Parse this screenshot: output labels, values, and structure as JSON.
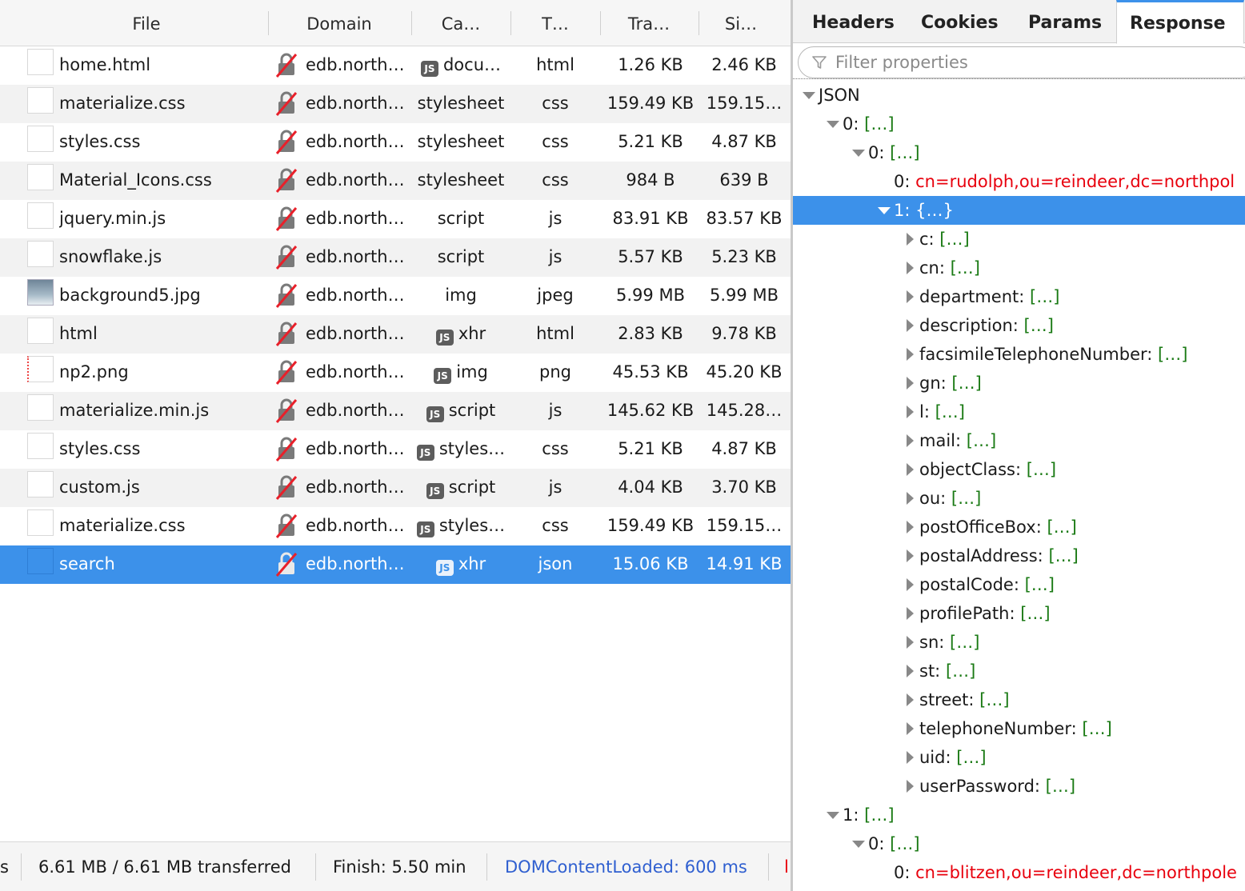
{
  "columns": {
    "file": "File",
    "domain": "Domain",
    "cause": "Ca…",
    "type": "T…",
    "transferred": "Tra…",
    "size": "Si…"
  },
  "requests": [
    {
      "file": "home.html",
      "domain": "edb.north…",
      "cause": "docu…",
      "cause_js": true,
      "type": "html",
      "transferred": "1.26 KB",
      "size": "2.46 KB",
      "thumb": "blank"
    },
    {
      "file": "materialize.css",
      "domain": "edb.north…",
      "cause": "stylesheet",
      "cause_js": false,
      "type": "css",
      "transferred": "159.49 KB",
      "size": "159.15…",
      "thumb": "blank"
    },
    {
      "file": "styles.css",
      "domain": "edb.north…",
      "cause": "stylesheet",
      "cause_js": false,
      "type": "css",
      "transferred": "5.21 KB",
      "size": "4.87 KB",
      "thumb": "blank"
    },
    {
      "file": "Material_Icons.css",
      "domain": "edb.north…",
      "cause": "stylesheet",
      "cause_js": false,
      "type": "css",
      "transferred": "984 B",
      "size": "639 B",
      "thumb": "blank"
    },
    {
      "file": "jquery.min.js",
      "domain": "edb.north…",
      "cause": "script",
      "cause_js": false,
      "type": "js",
      "transferred": "83.91 KB",
      "size": "83.57 KB",
      "thumb": "blank"
    },
    {
      "file": "snowflake.js",
      "domain": "edb.north…",
      "cause": "script",
      "cause_js": false,
      "type": "js",
      "transferred": "5.57 KB",
      "size": "5.23 KB",
      "thumb": "blank"
    },
    {
      "file": "background5.jpg",
      "domain": "edb.north…",
      "cause": "img",
      "cause_js": false,
      "type": "jpeg",
      "transferred": "5.99 MB",
      "size": "5.99 MB",
      "thumb": "img"
    },
    {
      "file": "html",
      "domain": "edb.north…",
      "cause": "xhr",
      "cause_js": true,
      "type": "html",
      "transferred": "2.83 KB",
      "size": "9.78 KB",
      "thumb": "blank"
    },
    {
      "file": "np2.png",
      "domain": "edb.north…",
      "cause": "img",
      "cause_js": true,
      "type": "png",
      "transferred": "45.53 KB",
      "size": "45.20 KB",
      "thumb": "png"
    },
    {
      "file": "materialize.min.js",
      "domain": "edb.north…",
      "cause": "script",
      "cause_js": true,
      "type": "js",
      "transferred": "145.62 KB",
      "size": "145.28…",
      "thumb": "blank"
    },
    {
      "file": "styles.css",
      "domain": "edb.north…",
      "cause": "styles…",
      "cause_js": true,
      "type": "css",
      "transferred": "5.21 KB",
      "size": "4.87 KB",
      "thumb": "blank"
    },
    {
      "file": "custom.js",
      "domain": "edb.north…",
      "cause": "script",
      "cause_js": true,
      "type": "js",
      "transferred": "4.04 KB",
      "size": "3.70 KB",
      "thumb": "blank"
    },
    {
      "file": "materialize.css",
      "domain": "edb.north…",
      "cause": "styles…",
      "cause_js": true,
      "type": "css",
      "transferred": "159.49 KB",
      "size": "159.15…",
      "thumb": "blank"
    },
    {
      "file": "search",
      "domain": "edb.north…",
      "cause": "xhr",
      "cause_js": true,
      "type": "json",
      "transferred": "15.06 KB",
      "size": "14.91 KB",
      "thumb": "blank",
      "selected": true
    }
  ],
  "js_badge": "JS",
  "status": {
    "requests_fragment": "s",
    "transferred": "6.61 MB / 6.61 MB transferred",
    "finish": "Finish: 5.50 min",
    "dom_content_loaded": "DOMContentLoaded: 600 ms",
    "load_fragment": "l"
  },
  "tabs": [
    "Headers",
    "Cookies",
    "Params",
    "Response"
  ],
  "active_tab": "Response",
  "filter": {
    "placeholder": "Filter properties"
  },
  "tree": [
    {
      "depth": 0,
      "twisty": "down",
      "key": "JSON",
      "value": ""
    },
    {
      "depth": 1,
      "twisty": "down",
      "key": "0: ",
      "value": "[…]"
    },
    {
      "depth": 2,
      "twisty": "down",
      "key": "0: ",
      "value": "[…]"
    },
    {
      "depth": 3,
      "twisty": "none",
      "key": "0: ",
      "value": "cn=rudolph,ou=reindeer,dc=northpol",
      "string": true
    },
    {
      "depth": 3,
      "twisty": "down",
      "key": "1: ",
      "value": "{…}",
      "selected": true
    },
    {
      "depth": 4,
      "twisty": "right",
      "key": "c: ",
      "value": "[…]"
    },
    {
      "depth": 4,
      "twisty": "right",
      "key": "cn: ",
      "value": "[…]"
    },
    {
      "depth": 4,
      "twisty": "right",
      "key": "department: ",
      "value": "[…]"
    },
    {
      "depth": 4,
      "twisty": "right",
      "key": "description: ",
      "value": "[…]"
    },
    {
      "depth": 4,
      "twisty": "right",
      "key": "facsimileTelephoneNumber: ",
      "value": "[…]"
    },
    {
      "depth": 4,
      "twisty": "right",
      "key": "gn: ",
      "value": "[…]"
    },
    {
      "depth": 4,
      "twisty": "right",
      "key": "l: ",
      "value": "[…]"
    },
    {
      "depth": 4,
      "twisty": "right",
      "key": "mail: ",
      "value": "[…]"
    },
    {
      "depth": 4,
      "twisty": "right",
      "key": "objectClass: ",
      "value": "[…]"
    },
    {
      "depth": 4,
      "twisty": "right",
      "key": "ou: ",
      "value": "[…]"
    },
    {
      "depth": 4,
      "twisty": "right",
      "key": "postOfficeBox: ",
      "value": "[…]"
    },
    {
      "depth": 4,
      "twisty": "right",
      "key": "postalAddress: ",
      "value": "[…]"
    },
    {
      "depth": 4,
      "twisty": "right",
      "key": "postalCode: ",
      "value": "[…]"
    },
    {
      "depth": 4,
      "twisty": "right",
      "key": "profilePath: ",
      "value": "[…]"
    },
    {
      "depth": 4,
      "twisty": "right",
      "key": "sn: ",
      "value": "[…]"
    },
    {
      "depth": 4,
      "twisty": "right",
      "key": "st: ",
      "value": "[…]"
    },
    {
      "depth": 4,
      "twisty": "right",
      "key": "street: ",
      "value": "[…]"
    },
    {
      "depth": 4,
      "twisty": "right",
      "key": "telephoneNumber: ",
      "value": "[…]"
    },
    {
      "depth": 4,
      "twisty": "right",
      "key": "uid: ",
      "value": "[…]"
    },
    {
      "depth": 4,
      "twisty": "right",
      "key": "userPassword: ",
      "value": "[…]"
    },
    {
      "depth": 1,
      "twisty": "down",
      "key": "1: ",
      "value": "[…]"
    },
    {
      "depth": 2,
      "twisty": "down",
      "key": "0: ",
      "value": "[…]"
    },
    {
      "depth": 3,
      "twisty": "none",
      "key": "0: ",
      "value": "cn=blitzen,ou=reindeer,dc=northpole",
      "string": true
    }
  ],
  "colors": {
    "selection": "#3c91ea",
    "string_value": "#e8000d",
    "collapsed_value": "#1a7a14",
    "dom_loaded": "#2f5fd0",
    "load_marker": "#e8000d"
  },
  "icons": {
    "insecure": "insecure-lock-icon",
    "filter": "filter-funnel-icon"
  }
}
